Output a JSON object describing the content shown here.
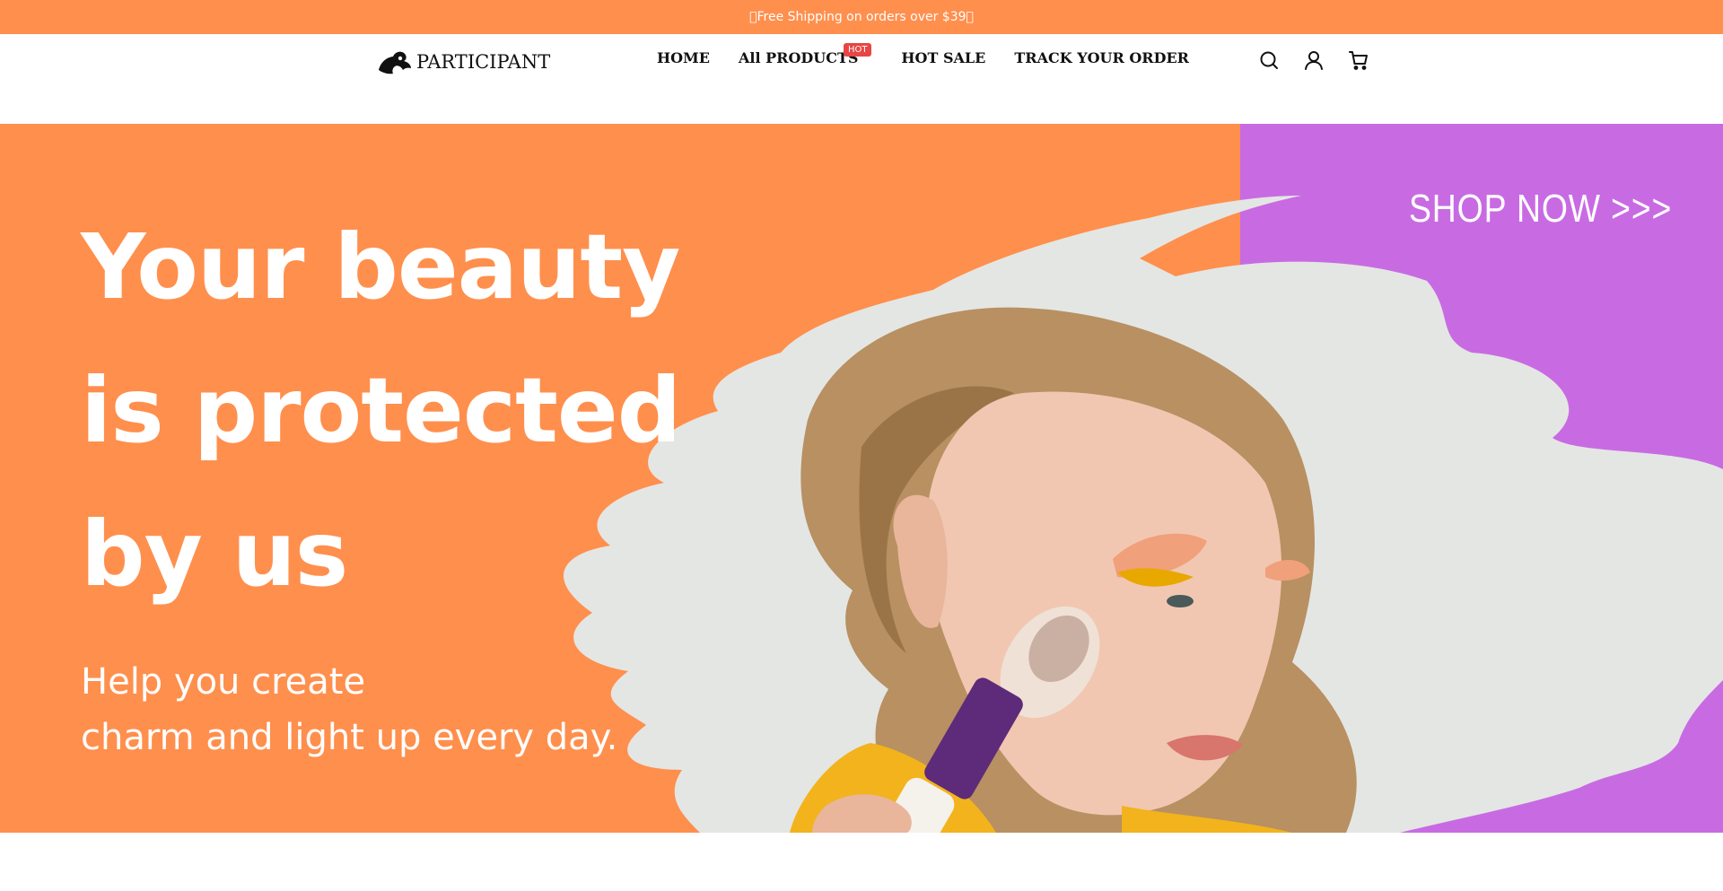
{
  "announcement": {
    "text": "\u0000Free Shipping on orders over $39\u0000"
  },
  "header": {
    "logo_text": "PARTICIPANT",
    "nav": {
      "home": "HOME",
      "all_products": "All PRODUCTS",
      "hot_badge": "HOT",
      "hot_sale": "HOT SALE",
      "track_order": "TRACK YOUR ORDER"
    },
    "icons": [
      "search-icon",
      "account-icon",
      "cart-icon"
    ]
  },
  "hero": {
    "headline_line1": "Your beauty",
    "headline_line2": "is protected",
    "headline_line3": "by us",
    "subline_line1": "Help you create",
    "subline_line2": "charm and light up every day.",
    "cta": "SHOP NOW >>>"
  },
  "colors": {
    "accent_orange": "#ff8f4d",
    "accent_purple": "#c86be3",
    "hot_badge": "#e84545"
  }
}
